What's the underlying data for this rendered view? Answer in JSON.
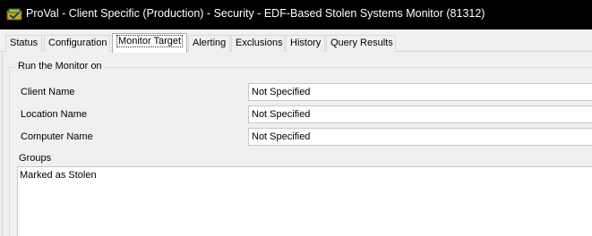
{
  "window": {
    "title": "ProVal - Client Specific (Production) - Security - EDF-Based Stolen Systems Monitor (81312)",
    "icon": "proval-app-icon"
  },
  "tabs": [
    {
      "label": "Status",
      "active": false
    },
    {
      "label": "Configuration",
      "active": false
    },
    {
      "label": "Monitor Target",
      "active": true
    },
    {
      "label": "Alerting",
      "active": false
    },
    {
      "label": "Exclusions",
      "active": false
    },
    {
      "label": "History",
      "active": false
    },
    {
      "label": "Query Results",
      "active": false
    }
  ],
  "target": {
    "group_title": "Run the Monitor on",
    "fields": [
      {
        "label": "Client Name",
        "value": "Not Specified"
      },
      {
        "label": "Location Name",
        "value": "Not Specified"
      },
      {
        "label": "Computer Name",
        "value": "Not Specified"
      }
    ],
    "groups_label": "Groups",
    "groups_value": "Marked as Stolen"
  }
}
